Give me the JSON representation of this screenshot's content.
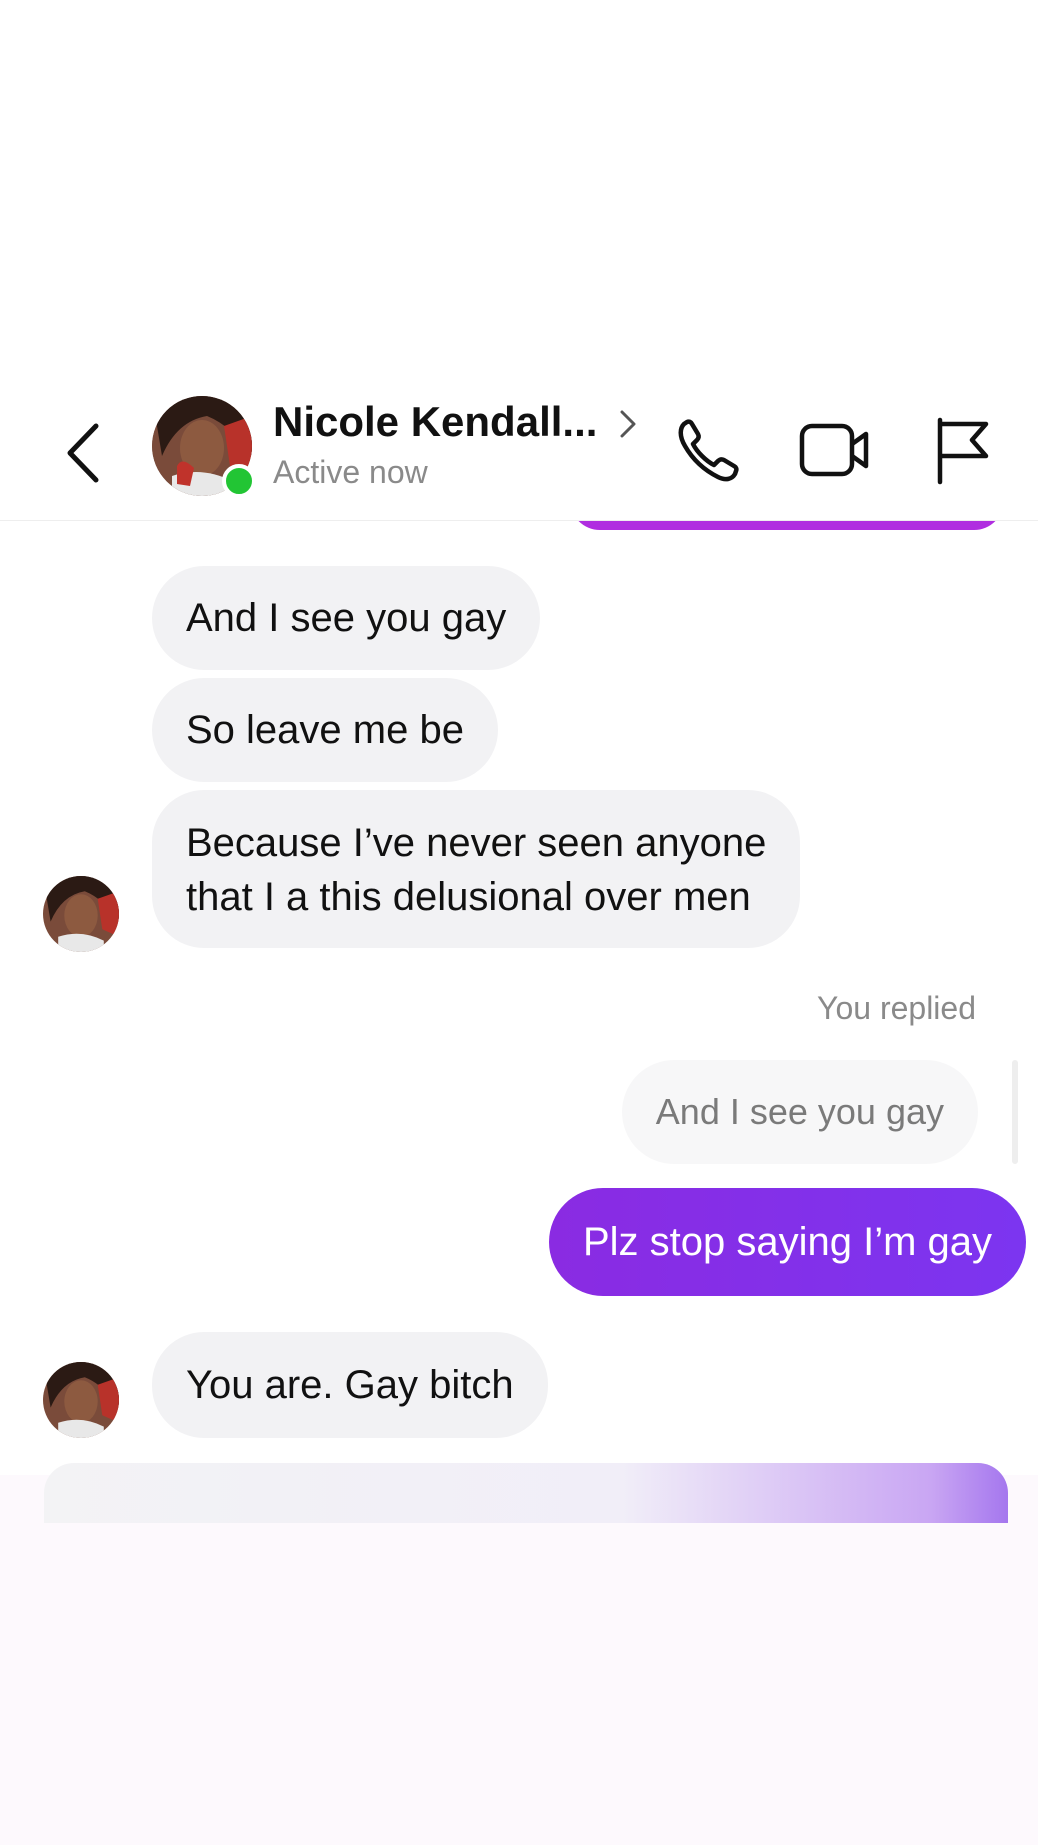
{
  "colors": {
    "accent": "#8a2be2",
    "online": "#22c534",
    "incoming_bubble": "#f2f2f4",
    "muted_text": "#8a8a8a"
  },
  "header": {
    "back_icon": "chevron-left-icon",
    "contact_name": "Nicole Kendall...",
    "contact_status": "Active now",
    "name_chevron_icon": "chevron-right-icon",
    "call_icon": "phone-icon",
    "video_icon": "video-camera-icon",
    "report_icon": "flag-icon"
  },
  "messages": [
    {
      "from": "contact",
      "text": "And I see you gay"
    },
    {
      "from": "contact",
      "text": "So leave me be"
    },
    {
      "from": "contact",
      "lines": [
        "Because I’ve never seen anyone",
        "that I a this delusional over men"
      ]
    },
    {
      "from": "me",
      "reply_label": "You replied",
      "quoted_text": "And I see you gay"
    },
    {
      "from": "me",
      "text": "Plz stop saying I’m gay"
    },
    {
      "from": "contact",
      "text": "You are. Gay bitch"
    }
  ]
}
